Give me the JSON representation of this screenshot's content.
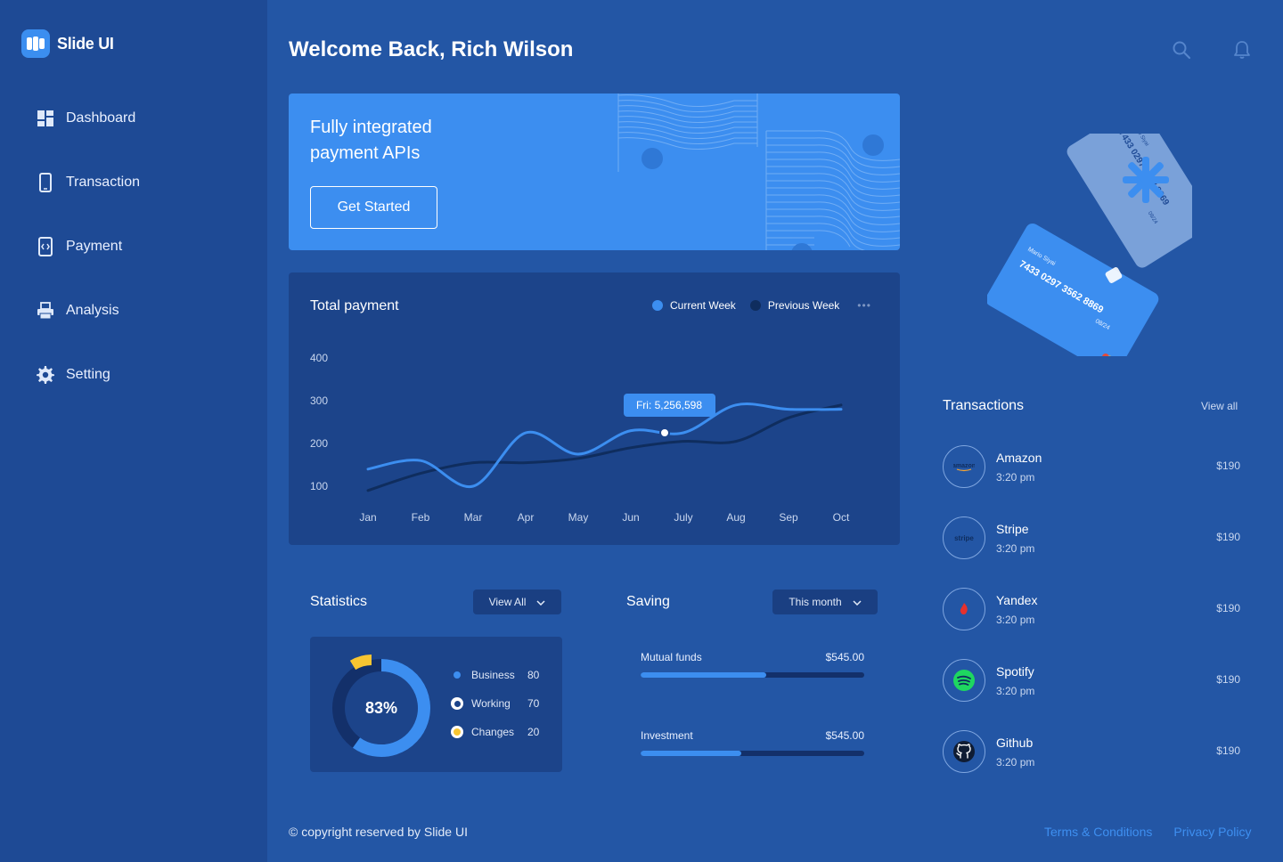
{
  "app": {
    "name": "Slide UI"
  },
  "sidebar": {
    "items": [
      {
        "label": "Dashboard",
        "icon": "dashboard-icon"
      },
      {
        "label": "Transaction",
        "icon": "phone-icon"
      },
      {
        "label": "Payment",
        "icon": "payment-icon"
      },
      {
        "label": "Analysis",
        "icon": "printer-icon"
      },
      {
        "label": "Setting",
        "icon": "gear-icon"
      }
    ]
  },
  "header": {
    "welcome": "Welcome Back, Rich Wilson",
    "icons": [
      "search-icon",
      "bell-icon"
    ]
  },
  "banner": {
    "title": "Fully integrated payment APIs",
    "button": "Get Started"
  },
  "payment_chart": {
    "title": "Total payment",
    "legend": [
      {
        "label": "Current Week",
        "color": "#3c8ef0"
      },
      {
        "label": "Previous Week",
        "color": "#0f2d5e"
      }
    ],
    "more": "•••",
    "tooltip": "Fri: 5,256,598"
  },
  "chart_data": {
    "type": "line",
    "title": "Total payment",
    "categories": [
      "Jan",
      "Feb",
      "Mar",
      "Apr",
      "May",
      "Jun",
      "July",
      "Aug",
      "Sep",
      "Oct"
    ],
    "yticks": [
      400,
      300,
      200,
      100
    ],
    "ylim": [
      100,
      400
    ],
    "series": [
      {
        "name": "Current Week",
        "color": "#3c8ef0",
        "values": [
          140,
          160,
          100,
          225,
          175,
          230,
          225,
          290,
          280,
          280
        ]
      },
      {
        "name": "Previous Week",
        "color": "#0f2d5e",
        "values": [
          90,
          130,
          155,
          155,
          165,
          190,
          205,
          205,
          260,
          290
        ]
      }
    ],
    "highlight": {
      "category": "Jun",
      "value": 225,
      "label": "Fri: 5,256,598"
    }
  },
  "statistics": {
    "title": "Statistics",
    "dropdown": "View All",
    "percent": "83%",
    "items": [
      {
        "label": "Business",
        "value": "80",
        "color": "#3c8ef0"
      },
      {
        "label": "Working",
        "value": "70",
        "color": "#ffffff"
      },
      {
        "label": "Changes",
        "value": "20",
        "color": "#f7c531"
      }
    ]
  },
  "saving": {
    "title": "Saving",
    "dropdown": "This month",
    "items": [
      {
        "label": "Mutual funds",
        "amount": "$545.00",
        "progress": 0.56
      },
      {
        "label": "Investment",
        "amount": "$545.00",
        "progress": 0.45
      }
    ]
  },
  "card_art": {
    "card_number": "7433 0297 3562 8869",
    "holder": "Mario Siyai",
    "expiry": "08/24"
  },
  "transactions": {
    "title": "Transactions",
    "view_all": "View all",
    "items": [
      {
        "name": "Amazon",
        "time": "3:20 pm",
        "amount": "$190",
        "icon": "amazon-icon",
        "mark": "amazon"
      },
      {
        "name": "Stripe",
        "time": "3:20 pm",
        "amount": "$190",
        "icon": "stripe-icon",
        "mark": "stripe"
      },
      {
        "name": "Yandex",
        "time": "3:20 pm",
        "amount": "$190",
        "icon": "yandex-icon"
      },
      {
        "name": "Spotify",
        "time": "3:20 pm",
        "amount": "$190",
        "icon": "spotify-icon"
      },
      {
        "name": "Github",
        "time": "3:20 pm",
        "amount": "$190",
        "icon": "github-icon"
      }
    ]
  },
  "footer": {
    "copyright": "© copyright reserved by Slide UI",
    "links": [
      "Terms & Conditions",
      "Privacy Policy"
    ]
  }
}
